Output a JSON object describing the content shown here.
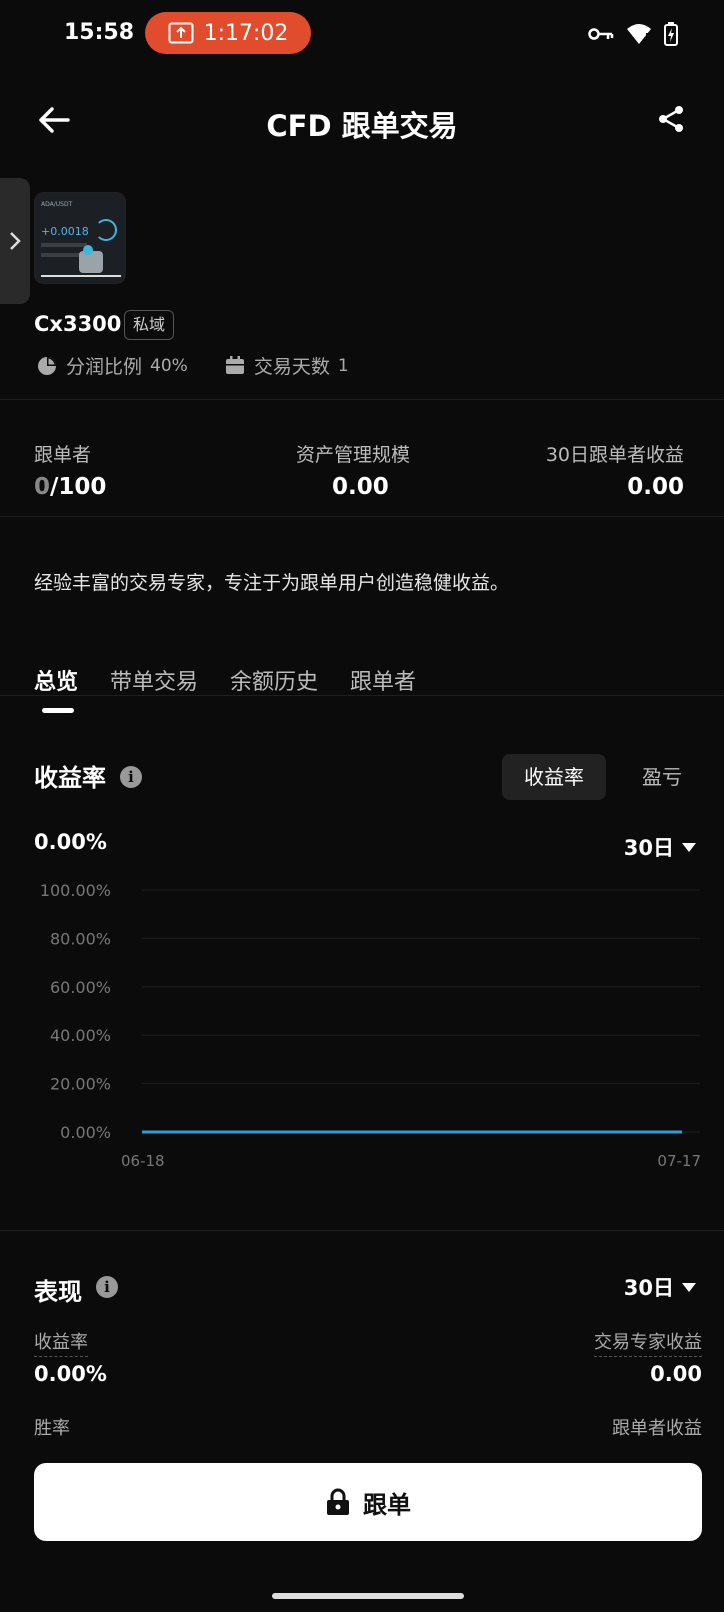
{
  "status": {
    "time": "15:58",
    "recording": "1:17:02"
  },
  "header": {
    "title": "CFD 跟单交易"
  },
  "profile": {
    "avatar_text_top": "ADA/USDT",
    "avatar_text_value": "+0.0018",
    "name": "Cx3300",
    "badge": "私域",
    "profit_share_label": "分润比例",
    "profit_share_value": "40%",
    "trading_days_label": "交易天数",
    "trading_days_value": "1"
  },
  "stats": {
    "followers_label": "跟单者",
    "followers_current": "0",
    "followers_total": "/100",
    "aum_label": "资产管理规模",
    "aum_value": "0.00",
    "pnl30_label": "30日跟单者收益",
    "pnl30_value": "0.00"
  },
  "intro": "经验丰富的交易专家，专注于为跟单用户创造稳健收益。",
  "tabs": [
    "总览",
    "带单交易",
    "余额历史",
    "跟单者"
  ],
  "chart_section": {
    "title": "收益率",
    "seg_on": "收益率",
    "seg_off": "盈亏",
    "current_value": "0.00%",
    "period": "30日"
  },
  "chart_data": {
    "type": "line",
    "x": [
      "06-18",
      "07-17"
    ],
    "series": [
      {
        "values": [
          0,
          0
        ],
        "color": "#2a9fd6"
      }
    ],
    "yticks": [
      "100.00%",
      "80.00%",
      "60.00%",
      "40.00%",
      "20.00%",
      "0.00%"
    ],
    "ylim": [
      0,
      100
    ],
    "grid": true
  },
  "performance": {
    "title": "表现",
    "period": "30日",
    "roi_label": "收益率",
    "roi_value": "0.00%",
    "expert_pnl_label": "交易专家收益",
    "expert_pnl_value": "0.00",
    "winrate_label": "胜率",
    "follower_pnl_label": "跟单者收益"
  },
  "action": {
    "follow_label": "跟单"
  }
}
